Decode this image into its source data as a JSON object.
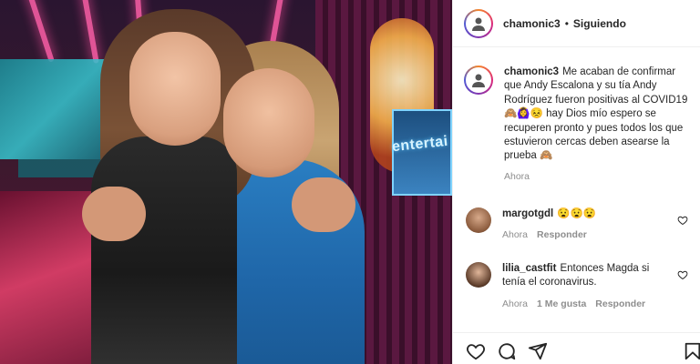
{
  "header": {
    "username": "chamonic3",
    "separator": "•",
    "follow_status": "Siguiendo"
  },
  "photo": {
    "sign_text": "entertai"
  },
  "caption": {
    "username": "chamonic3",
    "text": "Me acaban de confirmar que Andy Escalona y su tía Andy Rodríguez fueron positivas al COVID19 🙈🙆‍♀️😣 hay Dios mío espero se recuperen pronto y pues todos los que estuvieron cercas deben asearse la prueba 🙈",
    "time": "Ahora"
  },
  "comments": [
    {
      "username": "margotgdl",
      "text": "😧😧😧",
      "time": "Ahora",
      "reply_label": "Responder",
      "likes_label": ""
    },
    {
      "username": "lilia_castfit",
      "text": "Entonces Magda si tenía el coronavirus.",
      "time": "Ahora",
      "likes_label": "1 Me gusta",
      "reply_label": "Responder"
    }
  ],
  "icons": {
    "like": "heart-icon",
    "comment": "comment-icon",
    "share": "share-icon",
    "save": "bookmark-icon"
  },
  "colors": {
    "text_primary": "#262626",
    "text_secondary": "#8e8e8e",
    "divider": "#efefef"
  }
}
